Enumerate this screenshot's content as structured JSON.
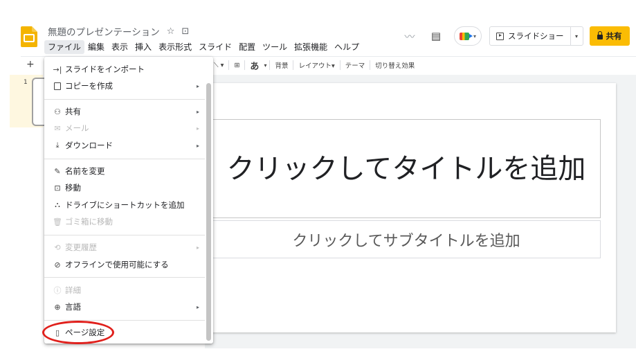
{
  "header": {
    "doc_title": "無題のプレゼンテーション",
    "star_icon": "☆",
    "folder_icon": "⊡",
    "menus": [
      "ファイル",
      "編集",
      "表示",
      "挿入",
      "表示形式",
      "スライド",
      "配置",
      "ツール",
      "拡張機能",
      "ヘルプ"
    ],
    "activity_icon": "〰",
    "comment_icon": "▤",
    "slideshow_label": "スライドショー",
    "dropdown_glyph": "▾",
    "share_label": "共有"
  },
  "toolbar": {
    "plus": "+",
    "text_glyph": "あ",
    "background": "背景",
    "layout": "レイアウト▾",
    "theme": "テーマ",
    "transition": "切り替え効果"
  },
  "filmstrip": {
    "slide_number": "1"
  },
  "slide": {
    "title_placeholder": "クリックしてタイトルを追加",
    "subtitle_placeholder": "クリックしてサブタイトルを追加"
  },
  "file_menu": {
    "submenu_glyph": "▸",
    "items": [
      {
        "icon": "import-icon",
        "label": "スライドをインポート",
        "disabled": false,
        "submenu": false
      },
      {
        "icon": "copy-icon",
        "label": "コピーを作成",
        "disabled": false,
        "submenu": true
      },
      {
        "icon": "share-person-icon",
        "label": "共有",
        "disabled": false,
        "submenu": true
      },
      {
        "icon": "mail-icon",
        "label": "メール",
        "disabled": true,
        "submenu": true
      },
      {
        "icon": "download-icon",
        "label": "ダウンロード",
        "disabled": false,
        "submenu": true
      },
      {
        "icon": "rename-icon",
        "label": "名前を変更",
        "disabled": false,
        "submenu": false
      },
      {
        "icon": "move-icon",
        "label": "移動",
        "disabled": false,
        "submenu": false
      },
      {
        "icon": "drive-shortcut-icon",
        "label": "ドライブにショートカットを追加",
        "disabled": false,
        "submenu": false
      },
      {
        "icon": "trash-icon",
        "label": "ゴミ箱に移動",
        "disabled": true,
        "submenu": false
      },
      {
        "icon": "history-icon",
        "label": "変更履歴",
        "disabled": true,
        "submenu": true
      },
      {
        "icon": "offline-icon",
        "label": "オフラインで使用可能にする",
        "disabled": false,
        "submenu": false
      },
      {
        "icon": "info-icon",
        "label": "詳細",
        "disabled": true,
        "submenu": false
      },
      {
        "icon": "globe-icon",
        "label": "言語",
        "disabled": false,
        "submenu": true
      },
      {
        "icon": "page-setup-icon",
        "label": "ページ設定",
        "disabled": false,
        "submenu": false
      }
    ]
  },
  "colors": {
    "share_button": "#fbbc04",
    "highlight_ring": "#e0201c",
    "slides_logo": "#f4b400",
    "filmstrip_selected": "#fef7e0"
  }
}
